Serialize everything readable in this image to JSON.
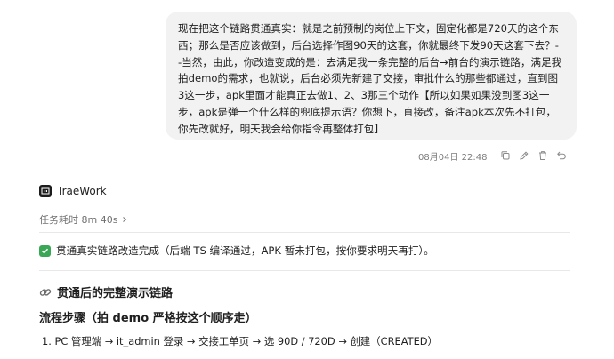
{
  "user_message": {
    "text": "现在把这个链路贯通真实：就是之前预制的岗位上下文，固定化都是720天的这个东西；那么是否应该做到，后台选择作图90天的这套，你就最终下发90天这套下去？--当然，由此，你改造变成的是：去满足我一条完整的后台→前台的演示链路，满足我拍demo的需求，也就说，后台必须先新建了交接，审批什么的那些都通过，直到图3这一步，apk里面才能真正去做1、2、3那三个动作【所以如果如果没到图3这一步，apk是弹一个什么样的兜底提示语？你想下，直接改，备注apk本次先不打包，你先改就好，明天我会给你指令再整体打包】",
    "timestamp": "08月04日 22:48"
  },
  "message_actions": [
    "copy-icon",
    "edit-icon",
    "delete-icon",
    "undo-icon"
  ],
  "agent": {
    "name": "TraeWork",
    "task_time": "任务耗时 8m 40s"
  },
  "response": {
    "status": "贯通真实链路改造完成（后端 TS 编译通过，APK 暂未打包，按你要求明天再打）。",
    "section_title": "贯通后的完整演示链路",
    "sub_title": "流程步骤（拍 demo 严格按这个顺序走）",
    "step_1": "1. PC 管理端 → it_admin 登录 → 交接工单页 → 选 90D / 720D → 创建（CREATED）"
  },
  "colors": {
    "bubble_bg": "#f2f2f3",
    "check_green": "#3aa757",
    "muted_text": "#7d7d7d"
  }
}
